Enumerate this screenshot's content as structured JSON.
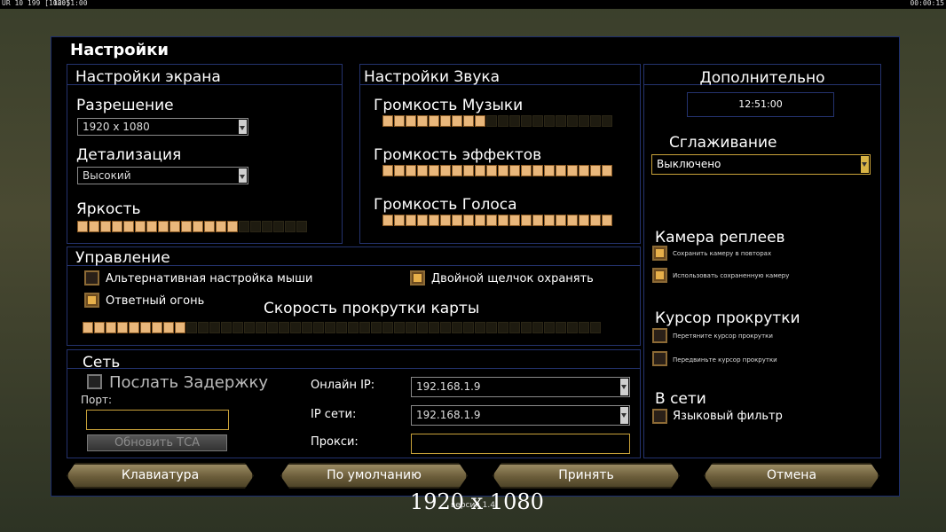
{
  "hud": {
    "left_status": "UR 10 199 [1080]",
    "left_time": "12:51:00",
    "right_time": "00:00:15"
  },
  "window": {
    "title": "Настройки"
  },
  "screen": {
    "title": "Настройки экрана",
    "resolution_label": "Разрешение",
    "resolution_value": "1920 x 1080",
    "detail_label": "Детализация",
    "detail_value": "Высокий",
    "brightness_label": "Яркость",
    "brightness_level": 0.7
  },
  "sound": {
    "title": "Настройки Звука",
    "music_label": "Громкость Музыки",
    "music_level": 0.45,
    "effects_label": "Громкость эффектов",
    "effects_level": 1.0,
    "voice_label": "Громкость Голоса",
    "voice_level": 1.0
  },
  "extra": {
    "title": "Дополнительно",
    "clock": "12:51:00",
    "aa_label": "Сглаживание",
    "aa_value": "Выключено",
    "replay_camera_label": "Камера реплеев",
    "replay_opt1": "Сохранить камеру в повторах",
    "replay_opt2": "Использовать сохраненную камеру",
    "cursor_label": "Курсор прокрутки",
    "cursor_opt1": "Перетяните курсор прокрутки",
    "cursor_opt2": "Передвиньте курсор прокрутки",
    "online_label": "В сети",
    "lang_filter": "Языковый фильтр"
  },
  "controls": {
    "title": "Управление",
    "alt_mouse": "Альтернативная настройка мыши",
    "double_click": "Двойной щелчок охранять",
    "retaliation": "Ответный огонь",
    "scroll_label": "Скорость прокрутки карты",
    "scroll_level": 0.2
  },
  "network": {
    "title": "Сеть",
    "send_delay": "Послать Задержку",
    "port_label": "Порт:",
    "update_tca": "Обновить ТСА",
    "online_ip_label": "Онлайн IP:",
    "online_ip_value": "192.168.1.9",
    "lan_ip_label": "IP сети:",
    "lan_ip_value": "192.168.1.9",
    "proxy_label": "Прокси:"
  },
  "buttons": {
    "keyboard": "Клавиатура",
    "defaults": "По умолчанию",
    "accept": "Принять",
    "cancel": "Отмена"
  },
  "footer": {
    "version": "версия 1.4",
    "resolution_overlay": "1920 x 1080"
  }
}
